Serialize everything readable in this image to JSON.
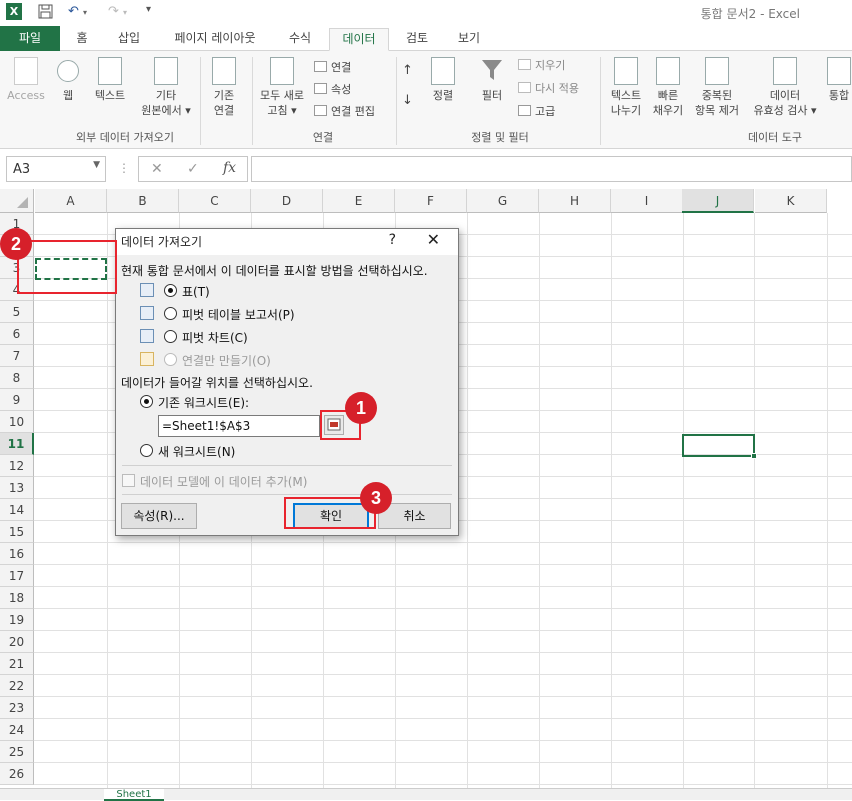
{
  "app": {
    "title": "통합 문서2 - Excel",
    "excel_logo": "X"
  },
  "colors": {
    "accent": "#217346",
    "marker": "#d6202a"
  },
  "tabs": [
    {
      "label": "파일",
      "state": "file"
    },
    {
      "label": "홈"
    },
    {
      "label": "삽입"
    },
    {
      "label": "페이지 레이아웃"
    },
    {
      "label": "수식"
    },
    {
      "label": "데이터",
      "state": "active"
    },
    {
      "label": "검토"
    },
    {
      "label": "보기"
    }
  ],
  "ribbon": {
    "external": {
      "access": "Access",
      "web": "웹",
      "text": "텍스트",
      "other1": "기타",
      "other2": "원본에서 ▾",
      "existing1": "기존",
      "existing2": "연결",
      "group": "외부 데이터 가져오기"
    },
    "connections": {
      "refresh1": "모두 새로",
      "refresh2": "고침 ▾",
      "connections": "연결",
      "properties": "속성",
      "edit_links": "연결 편집",
      "group": "연결"
    },
    "sort_filter": {
      "az": "↑",
      "za": "↓",
      "sort": "정렬",
      "filter": "필터",
      "clear": "지우기",
      "reapply": "다시 적용",
      "advanced": "고급",
      "group": "정렬 및 필터"
    },
    "tools": {
      "text_to_col1": "텍스트",
      "text_to_col2": "나누기",
      "flash1": "빠른",
      "flash2": "채우기",
      "dup1": "중복된",
      "dup2": "항목 제거",
      "valid1": "데이터",
      "valid2": "유효성 검사 ▾",
      "consolidate": "통합",
      "group": "데이터 도구"
    }
  },
  "formula_bar": {
    "name_box": "A3",
    "cancel": "✕",
    "enter": "✓",
    "fx": "fx",
    "value": ""
  },
  "columns": [
    "A",
    "B",
    "C",
    "D",
    "E",
    "F",
    "G",
    "H",
    "I",
    "J",
    "K"
  ],
  "selected_column": "J",
  "rows": [
    "1",
    "2",
    "3",
    "4",
    "5",
    "6",
    "7",
    "8",
    "9",
    "10",
    "11",
    "12",
    "13",
    "14",
    "15",
    "16",
    "17",
    "18",
    "19",
    "20",
    "21",
    "22",
    "23",
    "24",
    "25",
    "26"
  ],
  "selected_row": "11",
  "sheet_tab": "Sheet1",
  "dialog": {
    "title": "데이터 가져오기",
    "help": "?",
    "close": "✕",
    "prompt1": "현재 통합 문서에서 이 데이터를 표시할 방법을 선택하십시오.",
    "options": [
      {
        "label": "표(T)",
        "selected": true,
        "enabled": true
      },
      {
        "label": "피벗 테이블 보고서(P)",
        "selected": false,
        "enabled": true
      },
      {
        "label": "피벗 차트(C)",
        "selected": false,
        "enabled": true
      },
      {
        "label": "연결만 만들기(O)",
        "selected": false,
        "enabled": false
      }
    ],
    "prompt2": "데이터가 들어갈 위치를 선택하십시오.",
    "existing_sheet": "기존 워크시트(E):",
    "range_value": "=Sheet1!$A$3",
    "new_sheet": "새 워크시트(N)",
    "add_model": "데이터 모델에 이 데이터 추가(M)",
    "properties_btn": "속성(R)...",
    "ok_btn": "확인",
    "cancel_btn": "취소"
  },
  "annotations": {
    "m1": "1",
    "m2": "2",
    "m3": "3"
  }
}
